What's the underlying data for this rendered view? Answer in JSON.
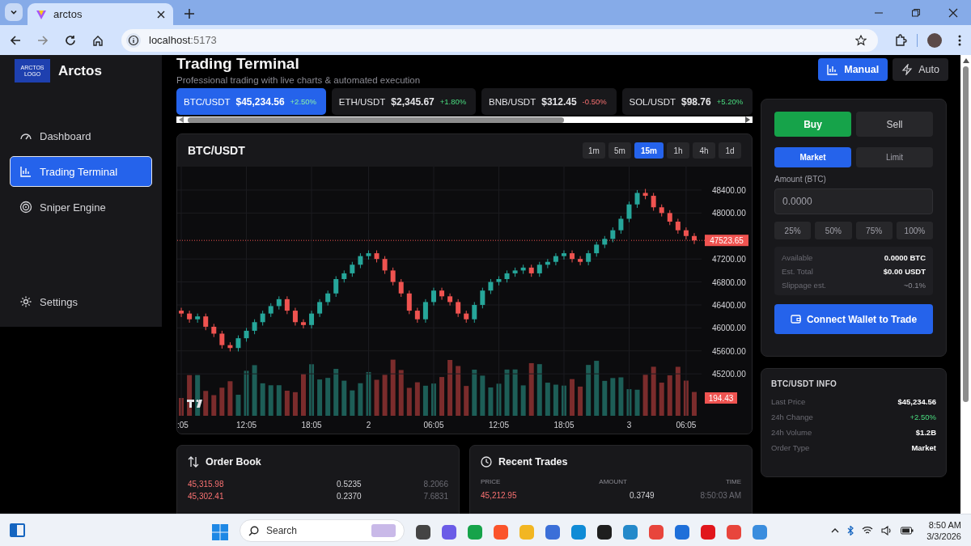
{
  "browser": {
    "tab_title": "arctos",
    "url_host": "localhost",
    "url_port": ":5173"
  },
  "sidebar": {
    "logo_text": "ARCTOS LOGO",
    "brand": "Arctos",
    "items": [
      {
        "label": "Dashboard",
        "selected": false
      },
      {
        "label": "Trading Terminal",
        "selected": true
      },
      {
        "label": "Sniper Engine",
        "selected": false
      }
    ],
    "settings": "Settings"
  },
  "header": {
    "title": "Trading Terminal",
    "subtitle": "Professional trading with live charts & automated execution",
    "modes": [
      {
        "label": "Manual",
        "selected": true
      },
      {
        "label": "Auto",
        "selected": false
      }
    ]
  },
  "tickers": [
    {
      "pair": "BTC/USDT",
      "price": "$45,234.56",
      "change": "+2.50%",
      "kind": "up",
      "selected": true
    },
    {
      "pair": "ETH/USDT",
      "price": "$2,345.67",
      "change": "+1.80%",
      "kind": "up",
      "selected": false
    },
    {
      "pair": "BNB/USDT",
      "price": "$312.45",
      "change": "-0.50%",
      "kind": "down",
      "selected": false
    },
    {
      "pair": "SOL/USDT",
      "price": "$98.76",
      "change": "+5.20%",
      "kind": "up",
      "selected": false
    }
  ],
  "chart": {
    "pair": "BTC/USDT",
    "intervals": [
      {
        "label": "1m",
        "selected": false
      },
      {
        "label": "5m",
        "selected": false
      },
      {
        "label": "15m",
        "selected": true
      },
      {
        "label": "1h",
        "selected": false
      },
      {
        "label": "4h",
        "selected": false
      },
      {
        "label": "1d",
        "selected": false
      }
    ],
    "last_price": "47523.65",
    "last_volume": "194.43",
    "chart_data": {
      "type": "candlestick",
      "grid": true,
      "ylim": [
        44470,
        48808
      ],
      "categories": [
        ":05",
        null,
        null,
        null,
        null,
        null,
        null,
        null,
        "12:05",
        null,
        null,
        null,
        null,
        null,
        null,
        null,
        "18:05",
        null,
        null,
        null,
        null,
        null,
        null,
        "2",
        null,
        null,
        null,
        null,
        null,
        null,
        null,
        "06:05",
        null,
        null,
        null,
        null,
        null,
        null,
        null,
        "12:05",
        null,
        null,
        null,
        null,
        null,
        null,
        null,
        "18:05",
        null,
        null,
        null,
        null,
        null,
        null,
        null,
        "3",
        null,
        null,
        null,
        null,
        null,
        null,
        "06:05",
        null
      ],
      "yticks": [
        {
          "value": 48400,
          "label": "48400.00"
        },
        {
          "value": 48000,
          "label": "48000.00"
        },
        {
          "value": 47200,
          "label": "47200.00"
        },
        {
          "value": 46800,
          "label": "46800.00"
        },
        {
          "value": 46400,
          "label": "46400.00"
        },
        {
          "value": 46000,
          "label": "46000.00"
        },
        {
          "value": 45600,
          "label": "45600.00"
        },
        {
          "value": 45200,
          "label": "45200.00"
        }
      ],
      "ohlc": [
        [
          46300,
          46350,
          46190,
          46250
        ],
        [
          46250,
          46300,
          46090,
          46150
        ],
        [
          46150,
          46250,
          46090,
          46200
        ],
        [
          46200,
          46250,
          45960,
          46020
        ],
        [
          46020,
          46070,
          45840,
          45900
        ],
        [
          45900,
          45950,
          45640,
          45700
        ],
        [
          45700,
          45750,
          45590,
          45650
        ],
        [
          45650,
          45870,
          45590,
          45820
        ],
        [
          45820,
          46000,
          45760,
          45950
        ],
        [
          45950,
          46150,
          45890,
          46100
        ],
        [
          46100,
          46300,
          46040,
          46250
        ],
        [
          46250,
          46430,
          46190,
          46380
        ],
        [
          46380,
          46550,
          46320,
          46500
        ],
        [
          46500,
          46550,
          46240,
          46300
        ],
        [
          46300,
          46350,
          46040,
          46100
        ],
        [
          46100,
          46150,
          45990,
          46050
        ],
        [
          46050,
          46300,
          45990,
          46250
        ],
        [
          46250,
          46500,
          46190,
          46450
        ],
        [
          46450,
          46650,
          46390,
          46600
        ],
        [
          46600,
          46900,
          46540,
          46850
        ],
        [
          46850,
          47000,
          46790,
          46950
        ],
        [
          46950,
          47150,
          46890,
          47100
        ],
        [
          47100,
          47300,
          47040,
          47250
        ],
        [
          47250,
          47350,
          47190,
          47300
        ],
        [
          47300,
          47350,
          47140,
          47200
        ],
        [
          47200,
          47250,
          46940,
          47000
        ],
        [
          47000,
          47050,
          46740,
          46800
        ],
        [
          46800,
          46850,
          46540,
          46600
        ],
        [
          46600,
          46650,
          46240,
          46300
        ],
        [
          46300,
          46350,
          46090,
          46150
        ],
        [
          46150,
          46500,
          46090,
          46450
        ],
        [
          46450,
          46700,
          46390,
          46650
        ],
        [
          46650,
          46700,
          46490,
          46550
        ],
        [
          46550,
          46600,
          46390,
          46450
        ],
        [
          46450,
          46500,
          46190,
          46250
        ],
        [
          46250,
          46300,
          46090,
          46150
        ],
        [
          46150,
          46450,
          46090,
          46400
        ],
        [
          46400,
          46700,
          46340,
          46650
        ],
        [
          46650,
          46850,
          46590,
          46800
        ],
        [
          46800,
          46900,
          46740,
          46850
        ],
        [
          46850,
          47000,
          46790,
          46950
        ],
        [
          46950,
          47050,
          46890,
          47000
        ],
        [
          47000,
          47100,
          46940,
          47050
        ],
        [
          47050,
          47100,
          46890,
          46950
        ],
        [
          46950,
          47150,
          46890,
          47100
        ],
        [
          47100,
          47200,
          47040,
          47150
        ],
        [
          47150,
          47300,
          47090,
          47250
        ],
        [
          47250,
          47350,
          47190,
          47300
        ],
        [
          47300,
          47350,
          47140,
          47200
        ],
        [
          47200,
          47250,
          47090,
          47150
        ],
        [
          47150,
          47350,
          47090,
          47300
        ],
        [
          47300,
          47500,
          47240,
          47450
        ],
        [
          47450,
          47600,
          47390,
          47550
        ],
        [
          47550,
          47750,
          47490,
          47700
        ],
        [
          47700,
          47950,
          47640,
          47900
        ],
        [
          47900,
          48200,
          47840,
          48150
        ],
        [
          48150,
          48400,
          48090,
          48350
        ],
        [
          48350,
          48420,
          48240,
          48300
        ],
        [
          48300,
          48350,
          48040,
          48100
        ],
        [
          48100,
          48150,
          47940,
          48000
        ],
        [
          48000,
          48050,
          47790,
          47850
        ],
        [
          47850,
          47900,
          47640,
          47700
        ],
        [
          47700,
          47750,
          47540,
          47600
        ],
        [
          47600,
          47650,
          47460,
          47523.65
        ]
      ]
    }
  },
  "order_form": {
    "sides": [
      {
        "label": "Buy",
        "kind": "buy",
        "selected": true
      },
      {
        "label": "Sell",
        "kind": "sell",
        "selected": false
      }
    ],
    "types": [
      {
        "label": "Market",
        "selected": true
      },
      {
        "label": "Limit",
        "selected": false
      }
    ],
    "amount_label": "Amount (BTC)",
    "amount_placeholder": "0.0000",
    "presets": [
      "25%",
      "50%",
      "75%",
      "100%"
    ],
    "summary": [
      {
        "label": "Available",
        "value": "0.0000 BTC",
        "kind": "strong"
      },
      {
        "label": "Est. Total",
        "value": "$0.00 USDT",
        "kind": "strong"
      },
      {
        "label": "Slippage est.",
        "value": "~0.1%",
        "kind": "muted"
      }
    ],
    "connect_button": "Connect Wallet to Trade"
  },
  "info": {
    "title": "BTC/USDT INFO",
    "rows": [
      {
        "label": "Last Price",
        "value": "$45,234.56",
        "kind": "plain"
      },
      {
        "label": "24h Change",
        "value": "+2.50%",
        "kind": "up"
      },
      {
        "label": "24h Volume",
        "value": "$1.2B",
        "kind": "plain"
      },
      {
        "label": "Order Type",
        "value": "Market",
        "kind": "plain"
      }
    ]
  },
  "order_book": {
    "title": "Order Book",
    "rows": [
      {
        "price": "45,315.98",
        "amount": "0.5235",
        "total": "8.2066"
      },
      {
        "price": "45,302.41",
        "amount": "0.2370",
        "total": "7.6831"
      }
    ]
  },
  "recent_trades": {
    "title": "Recent Trades",
    "columns": [
      "PRICE",
      "AMOUNT",
      "TIME"
    ],
    "rows": [
      {
        "price": "45,212.95",
        "amount": "0.3749",
        "time": "8:50:03 AM",
        "kind": "sell"
      }
    ]
  },
  "taskbar": {
    "search": "Search",
    "time": "8:50 AM",
    "date": "3/3/2026"
  }
}
